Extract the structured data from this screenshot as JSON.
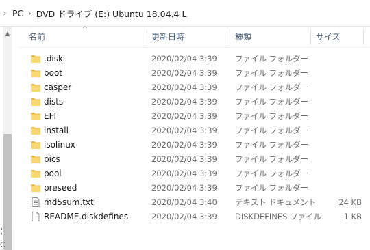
{
  "address": {
    "crumbs": [
      "PC",
      "DVD ドライブ (E:) Ubuntu 18.04.4 L"
    ]
  },
  "nav": {
    "cut_label_1": "(",
    "cut_label_2": "C"
  },
  "columns": {
    "name": "名前",
    "date": "更新日時",
    "type": "種類",
    "size": "サイズ"
  },
  "files": [
    {
      "name": ".disk",
      "date": "2020/02/04 3:39",
      "type": "ファイル フォルダー",
      "size": "",
      "icon": "folder-icon"
    },
    {
      "name": "boot",
      "date": "2020/02/04 3:39",
      "type": "ファイル フォルダー",
      "size": "",
      "icon": "folder-icon"
    },
    {
      "name": "casper",
      "date": "2020/02/04 3:39",
      "type": "ファイル フォルダー",
      "size": "",
      "icon": "folder-icon"
    },
    {
      "name": "dists",
      "date": "2020/02/04 3:39",
      "type": "ファイル フォルダー",
      "size": "",
      "icon": "folder-icon"
    },
    {
      "name": "EFI",
      "date": "2020/02/04 3:39",
      "type": "ファイル フォルダー",
      "size": "",
      "icon": "folder-icon"
    },
    {
      "name": "install",
      "date": "2020/02/04 3:39",
      "type": "ファイル フォルダー",
      "size": "",
      "icon": "folder-icon"
    },
    {
      "name": "isolinux",
      "date": "2020/02/04 3:39",
      "type": "ファイル フォルダー",
      "size": "",
      "icon": "folder-icon"
    },
    {
      "name": "pics",
      "date": "2020/02/04 3:39",
      "type": "ファイル フォルダー",
      "size": "",
      "icon": "folder-icon"
    },
    {
      "name": "pool",
      "date": "2020/02/04 3:39",
      "type": "ファイル フォルダー",
      "size": "",
      "icon": "folder-icon"
    },
    {
      "name": "preseed",
      "date": "2020/02/04 3:39",
      "type": "ファイル フォルダー",
      "size": "",
      "icon": "folder-icon"
    },
    {
      "name": "md5sum.txt",
      "date": "2020/02/04 3:40",
      "type": "テキスト ドキュメント",
      "size": "24 KB",
      "icon": "text-file-icon"
    },
    {
      "name": "README.diskdefines",
      "date": "2020/02/04 3:39",
      "type": "DISKDEFINES ファイル",
      "size": "1 KB",
      "icon": "file-icon"
    }
  ],
  "colors": {
    "folder": "#f8d775",
    "folder_dark": "#e8b84a",
    "header_text": "#4c607a"
  }
}
